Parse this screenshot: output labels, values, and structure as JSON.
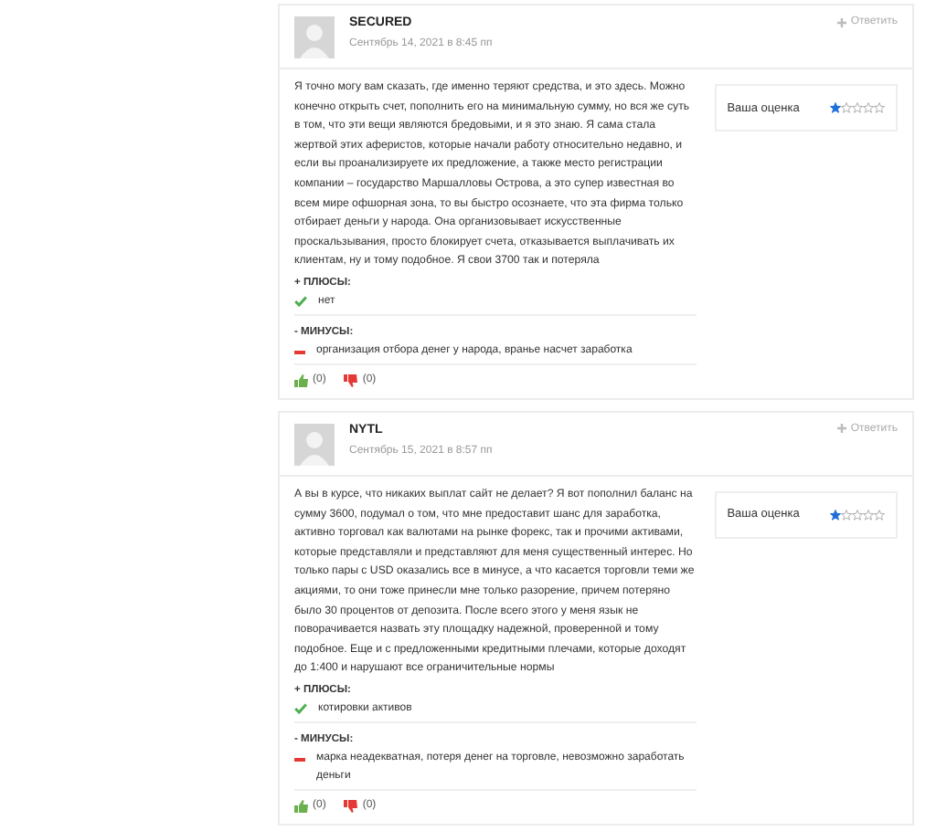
{
  "reviews": [
    {
      "author": "SECURED",
      "date": "Сентябрь 14, 2021 в 8:45 пп",
      "reply": "Ответить",
      "text": "Я точно могу вам сказать, где именно теряют средства, и это здесь. Можно конечно открыть счет, пополнить его на минимальную сумму, но вся же суть в том, что эти вещи являются бредовыми, и я это знаю. Я сама стала жертвой этих аферистов, которые начали работу относительно недавно, и если вы проанализируете их предложение, а также место регистрации компании – государство Маршалловы Острова, а это супер известная во всем мире офшорная зона, то вы быстро осознаете, что эта фирма только отбирает деньги у народа. Она организовывает искусственные проскальзывания, просто блокирует счета, отказывается выплачивать их клиентам, ну и тому подобное. Я свои 3700 так и потеряла",
      "rating_label": "Ваша оценка",
      "stars": 1,
      "pros_label": "+ ПЛЮСЫ:",
      "pros": [
        "нет"
      ],
      "cons_label": "- МИНУСЫ:",
      "cons": [
        "организация отбора денег у народа, вранье насчет заработка"
      ],
      "likes": "(0)",
      "dislikes": "(0)"
    },
    {
      "author": "NYTL",
      "date": "Сентябрь 15, 2021 в 8:57 пп",
      "reply": "Ответить",
      "text": "А вы в курсе, что никаких выплат сайт не делает? Я вот пополнил баланс на сумму 3600, подумал о том, что мне предоставит шанс для заработка, активно торговал как валютами на рынке форекс, так и прочими активами, которые представляли и представляют для меня существенный интерес. Но только пары с USD оказались все в минусе, а что касается торговли теми же акциями, то они тоже принесли мне только разорение, причем потеряно было 30 процентов от депозита. После всего этого у меня язык не поворачивается назвать эту площадку надежной, проверенной и тому подобное. Еще и с предложенными кредитными плечами, которые доходят до 1:400 и нарушают все ограничительные нормы",
      "rating_label": "Ваша оценка",
      "stars": 1,
      "pros_label": "+ ПЛЮСЫ:",
      "pros": [
        "котировки активов"
      ],
      "cons_label": "- МИНУСЫ:",
      "cons": [
        "марка неадекватная, потеря денег на торговле, невозможно заработать деньги"
      ],
      "likes": "(0)",
      "dislikes": "(0)"
    }
  ]
}
